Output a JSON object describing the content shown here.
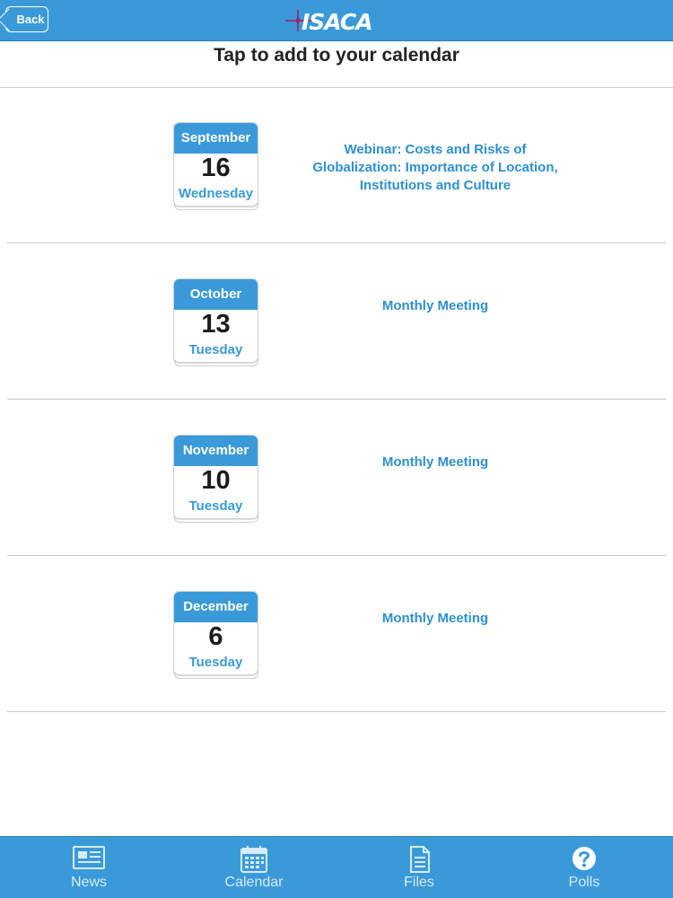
{
  "header": {
    "back_label": "Back",
    "logo_text": "ISACA"
  },
  "page": {
    "title": "Tap to add to your calendar"
  },
  "events": [
    {
      "month": "September",
      "day": "16",
      "weekday": "Wednesday",
      "title": "Webinar: Costs and Risks of Globalization: Importance of Location, Institutions and Culture"
    },
    {
      "month": "October",
      "day": "13",
      "weekday": "Tuesday",
      "title": "Monthly Meeting"
    },
    {
      "month": "November",
      "day": "10",
      "weekday": "Tuesday",
      "title": "Monthly Meeting"
    },
    {
      "month": "December",
      "day": "6",
      "weekday": "Tuesday",
      "title": "Monthly Meeting"
    }
  ],
  "tabbar": {
    "tabs": [
      {
        "label": "News",
        "icon": "newspaper-icon"
      },
      {
        "label": "Calendar",
        "icon": "calendar-icon"
      },
      {
        "label": "Files",
        "icon": "document-icon"
      },
      {
        "label": "Polls",
        "icon": "question-circle-icon"
      }
    ]
  },
  "colors": {
    "brand_blue": "#3a9ad9",
    "link_blue": "#2e8fd0",
    "logo_accent": "#b0185e"
  }
}
